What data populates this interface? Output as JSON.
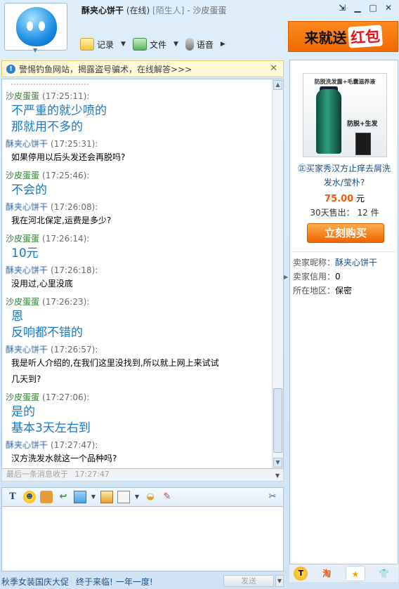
{
  "window": {
    "nickname": "酥夹心饼干",
    "status": "(在线)",
    "stranger_tag": "[陌生人]",
    "separator": "-",
    "peer_name": "沙皮蛋蛋"
  },
  "toolbar": {
    "record_label": "记录",
    "file_label": "文件",
    "voice_label": "语音"
  },
  "promo": {
    "text1": "来就送",
    "text2": "红包"
  },
  "warning": {
    "text": "警惕钓鱼网站，揭露盗号骗术，在线解答>>>"
  },
  "messages": [
    {
      "sender": "沙皮蛋蛋",
      "time": "(17:25:11):",
      "lines": [
        "不严重的就少喷的",
        "那就用不多的"
      ],
      "style": "big"
    },
    {
      "sender": "酥夹心饼干",
      "time": "(17:25:31):",
      "lines": [
        "如果停用以后头发还会再脱吗?"
      ],
      "style": "small"
    },
    {
      "sender": "沙皮蛋蛋",
      "time": "(17:25:46):",
      "lines": [
        "不会的"
      ],
      "style": "big"
    },
    {
      "sender": "酥夹心饼干",
      "time": "(17:26:08):",
      "lines": [
        "我在河北保定,运费是多少?"
      ],
      "style": "small"
    },
    {
      "sender": "沙皮蛋蛋",
      "time": "(17:26:14):",
      "lines": [
        "10元"
      ],
      "style": "big"
    },
    {
      "sender": "酥夹心饼干",
      "time": "(17:26:18):",
      "lines": [
        "没用过,心里没底"
      ],
      "style": "small"
    },
    {
      "sender": "沙皮蛋蛋",
      "time": "(17:26:23):",
      "lines": [
        "恩",
        "反响都不错的"
      ],
      "style": "big"
    },
    {
      "sender": "酥夹心饼干",
      "time": "(17:26:57):",
      "lines": [
        "我是听人介绍的,在我们这里没找到,所以就上网上来试试",
        "几天到?"
      ],
      "style": "small"
    },
    {
      "sender": "沙皮蛋蛋",
      "time": "(17:27:06):",
      "lines": [
        "是的",
        "基本3天左右到"
      ],
      "style": "big"
    },
    {
      "sender": "酥夹心饼干",
      "time": "(17:27:47):",
      "lines": [
        "汉方洗发水就这一个品种吗?"
      ],
      "style": "small"
    }
  ],
  "last_message": {
    "label": "最后一条消息收于",
    "time": "17:27:47"
  },
  "footer": {
    "ad1": "秋季女装国庆大促",
    "ad2": "终于来临!",
    "ad3": "一年一度!",
    "send_label": "发送"
  },
  "product": {
    "image_headline": "防脱洗发露+毛囊滋养液",
    "image_slogan": "防脱+生发",
    "title": "㊣买家秀汉方止痒去屑洗发水/莹朴?",
    "price": "75.00",
    "price_unit": "元",
    "sold_label": "30天售出：",
    "sold_count": "12",
    "sold_unit": "件",
    "buy_label": "立刻购买"
  },
  "seller": {
    "nick_label": "卖家昵称：",
    "nick_value": "酥夹心饼干",
    "credit_label": "卖家信用：",
    "credit_value": "0",
    "region_label": "所在地区：",
    "region_value": "保密"
  },
  "colors": {
    "peer_name": "#2f7b2f",
    "big_text": "#1878c8",
    "link": "#1c4f87",
    "price": "#ff5500",
    "buy_button": "#f06400"
  }
}
